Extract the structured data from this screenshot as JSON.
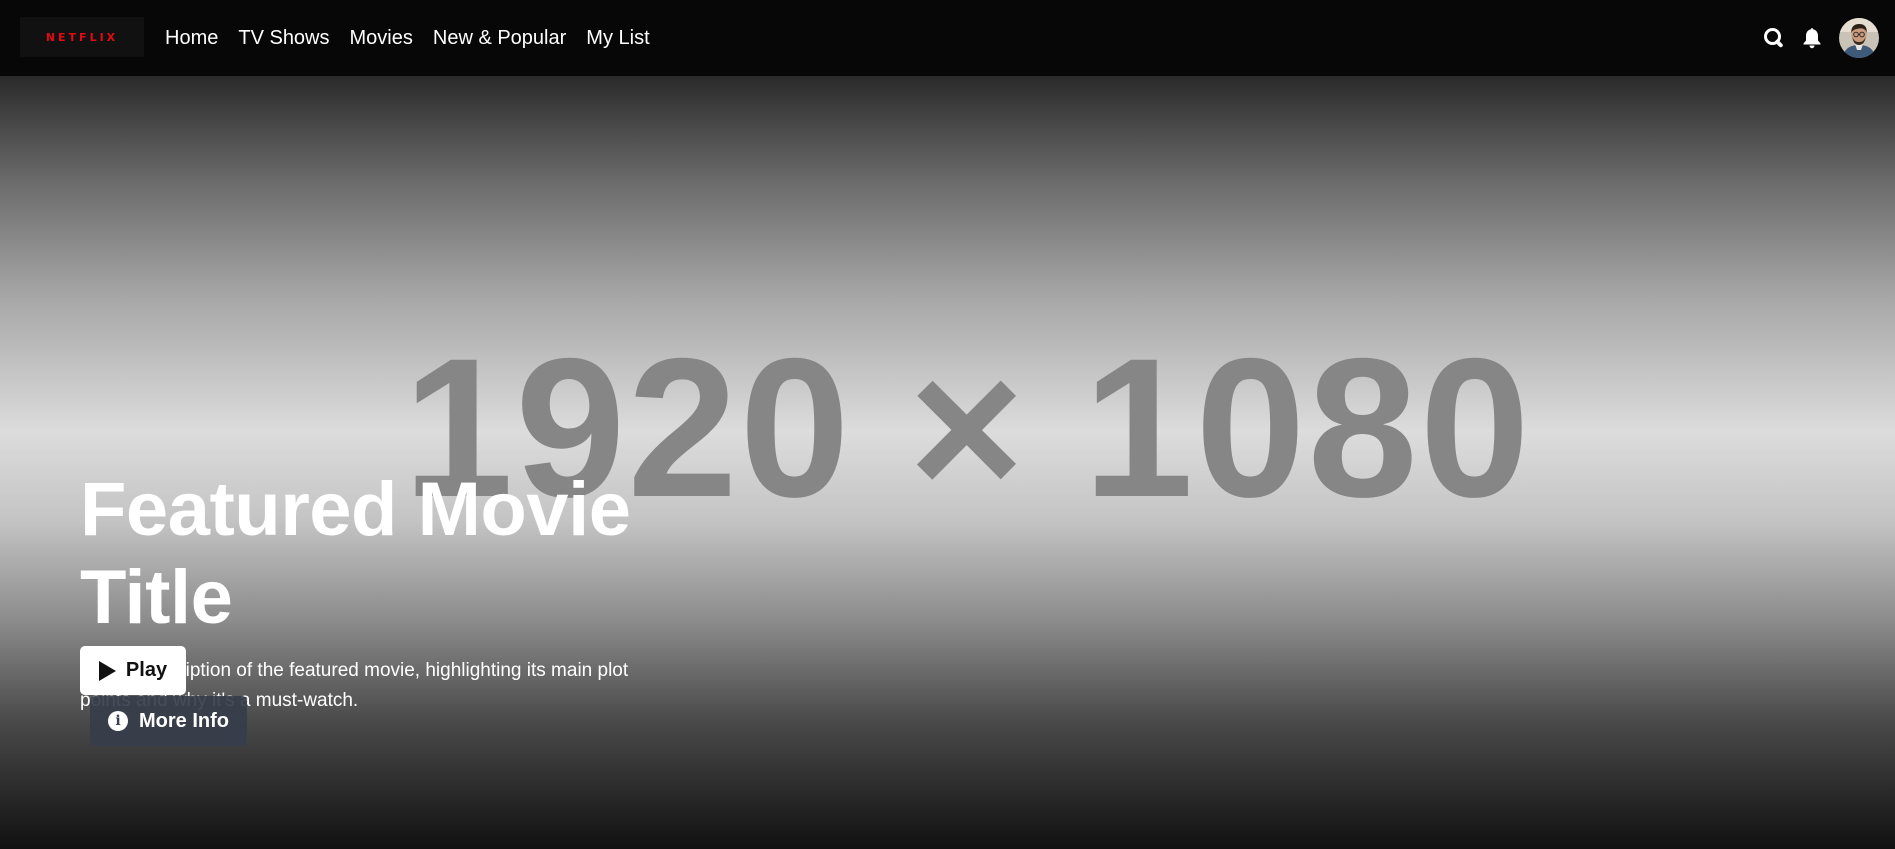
{
  "brand": {
    "logo_text": "NETFLIX",
    "logo_color": "#e50914"
  },
  "nav": {
    "items": [
      {
        "label": "Home"
      },
      {
        "label": "TV Shows"
      },
      {
        "label": "Movies"
      },
      {
        "label": "New & Popular"
      },
      {
        "label": "My List"
      }
    ],
    "icons": [
      "search-icon",
      "bell-icon",
      "avatar"
    ]
  },
  "hero": {
    "placeholder_label": "1920 × 1080",
    "title": "Featured Movie Title",
    "description": "A brief description of the featured movie, highlighting its main plot points and why it's a must-watch.",
    "play_label": "Play",
    "more_info_label": "More Info",
    "play_icon": "play-icon",
    "info_icon": "info-icon"
  },
  "colors": {
    "nav_background": "#070707",
    "play_button_background": "#ffffff",
    "more_info_background": "#373e4a"
  }
}
